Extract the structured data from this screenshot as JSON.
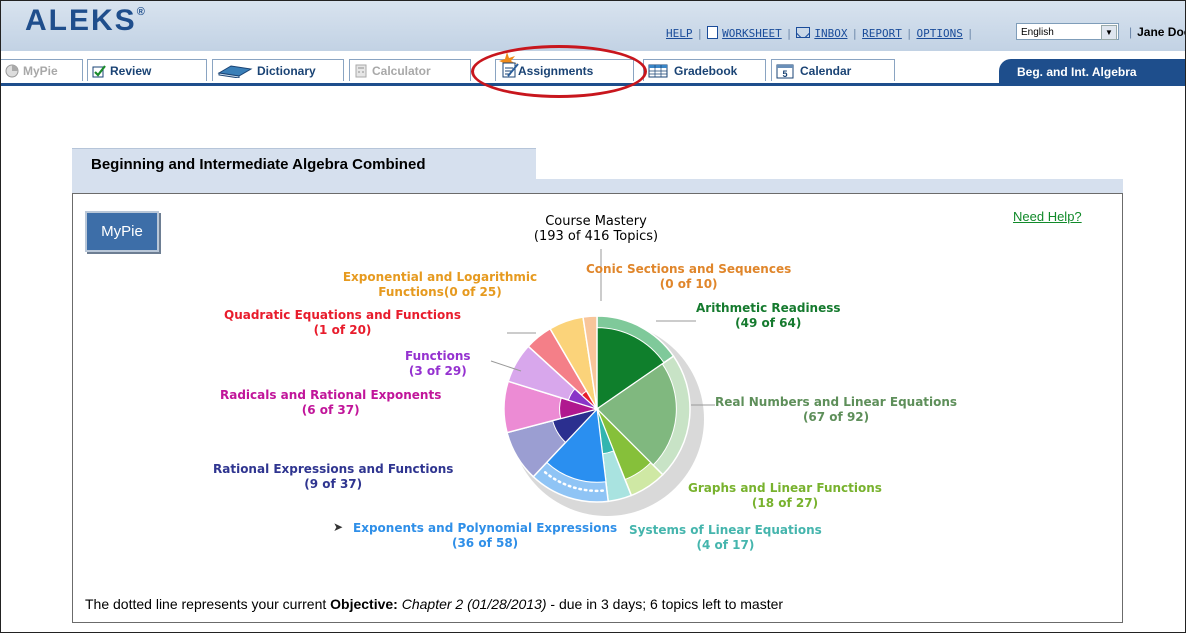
{
  "app": {
    "logo": "ALEKS",
    "logo_mark": "®"
  },
  "toplinks": {
    "help": "HELP",
    "worksheet": "WORKSHEET",
    "inbox": "INBOX",
    "report": "REPORT",
    "options": "OPTIONS"
  },
  "language": {
    "selected": "English"
  },
  "user": {
    "name": "Jane Doe"
  },
  "nav": {
    "tabs": [
      {
        "label": "MyPie",
        "enabled": false
      },
      {
        "label": "Review",
        "enabled": true
      },
      {
        "label": "Dictionary",
        "enabled": true
      },
      {
        "label": "Calculator",
        "enabled": false
      },
      {
        "label": "Assignments",
        "enabled": true,
        "highlighted": true
      },
      {
        "label": "Gradebook",
        "enabled": true
      },
      {
        "label": "Calendar",
        "enabled": true
      }
    ],
    "course_badge": "Beg. and Int. Algebra"
  },
  "panel": {
    "title": "Beginning and Intermediate Algebra Combined",
    "mypie_button": "MyPie",
    "need_help": "Need Help?",
    "mastery_title": "Course Mastery",
    "mastery_count": "(193 of 416 Topics)",
    "objective_prefix": "The dotted line represents your current ",
    "objective_label": "Objective:",
    "objective_name": "Chapter 2 (01/28/2013)",
    "objective_suffix": " - due in 3 days; 6 topics left to master"
  },
  "chart_data": {
    "type": "pie",
    "title": "Course Mastery",
    "subtitle": "(193 of 416 Topics)",
    "slices": [
      {
        "name": "Arithmetic Readiness",
        "count_label": "(49 of 64)",
        "mastered": 49,
        "total": 64,
        "color": "#0f7f2c",
        "light": "#7fc99a",
        "label_color": "#157a2e"
      },
      {
        "name": "Real Numbers and Linear Equations",
        "count_label": "(67 of 92)",
        "mastered": 67,
        "total": 92,
        "color": "#80b87f",
        "light": "#c8e3c6",
        "label_color": "#5e8f5a"
      },
      {
        "name": "Graphs and Linear Functions",
        "count_label": "(18 of 27)",
        "mastered": 18,
        "total": 27,
        "color": "#86c03a",
        "light": "#cfe8a4",
        "label_color": "#78b22e"
      },
      {
        "name": "Systems of Linear Equations",
        "count_label": "(4 of 17)",
        "mastered": 4,
        "total": 17,
        "color": "#31b5b0",
        "light": "#a9e3e0",
        "label_color": "#45b5ad"
      },
      {
        "name": "Exponents and Polynomial Expressions",
        "count_label": "(36 of 58)",
        "mastered": 36,
        "total": 58,
        "color": "#2a8ff0",
        "light": "#8fc4f5",
        "label_color": "#2f8fe8",
        "current": true
      },
      {
        "name": "Rational Expressions and Functions",
        "count_label": "(9 of 37)",
        "mastered": 9,
        "total": 37,
        "color": "#2b2f8f",
        "light": "#9b9ed2",
        "label_color": "#2f3590"
      },
      {
        "name": "Radicals and Rational Exponents",
        "count_label": "(6 of 37)",
        "mastered": 6,
        "total": 37,
        "color": "#b0188f",
        "light": "#ec8bd4",
        "label_color": "#c1159a"
      },
      {
        "name": "Functions",
        "count_label": "(3 of 29)",
        "mastered": 3,
        "total": 29,
        "color": "#8a35c8",
        "light": "#d8a7ec",
        "label_color": "#9532d0"
      },
      {
        "name": "Quadratic Equations and Functions",
        "count_label": "(1 of 20)",
        "mastered": 1,
        "total": 20,
        "color": "#e81c2c",
        "light": "#f47f88",
        "label_color": "#e81c2c"
      },
      {
        "name": "Exponential and Logarithmic Functions",
        "count_label": "(0 of 25)",
        "mastered": 0,
        "total": 25,
        "color": "#e8a418",
        "light": "#fbd37a",
        "label_color": "#e69a1f"
      },
      {
        "name": "Conic Sections and Sequences",
        "count_label": "(0 of 10)",
        "mastered": 0,
        "total": 10,
        "color": "#e58a2e",
        "light": "#f8c59a",
        "label_color": "#e0862b"
      }
    ]
  }
}
